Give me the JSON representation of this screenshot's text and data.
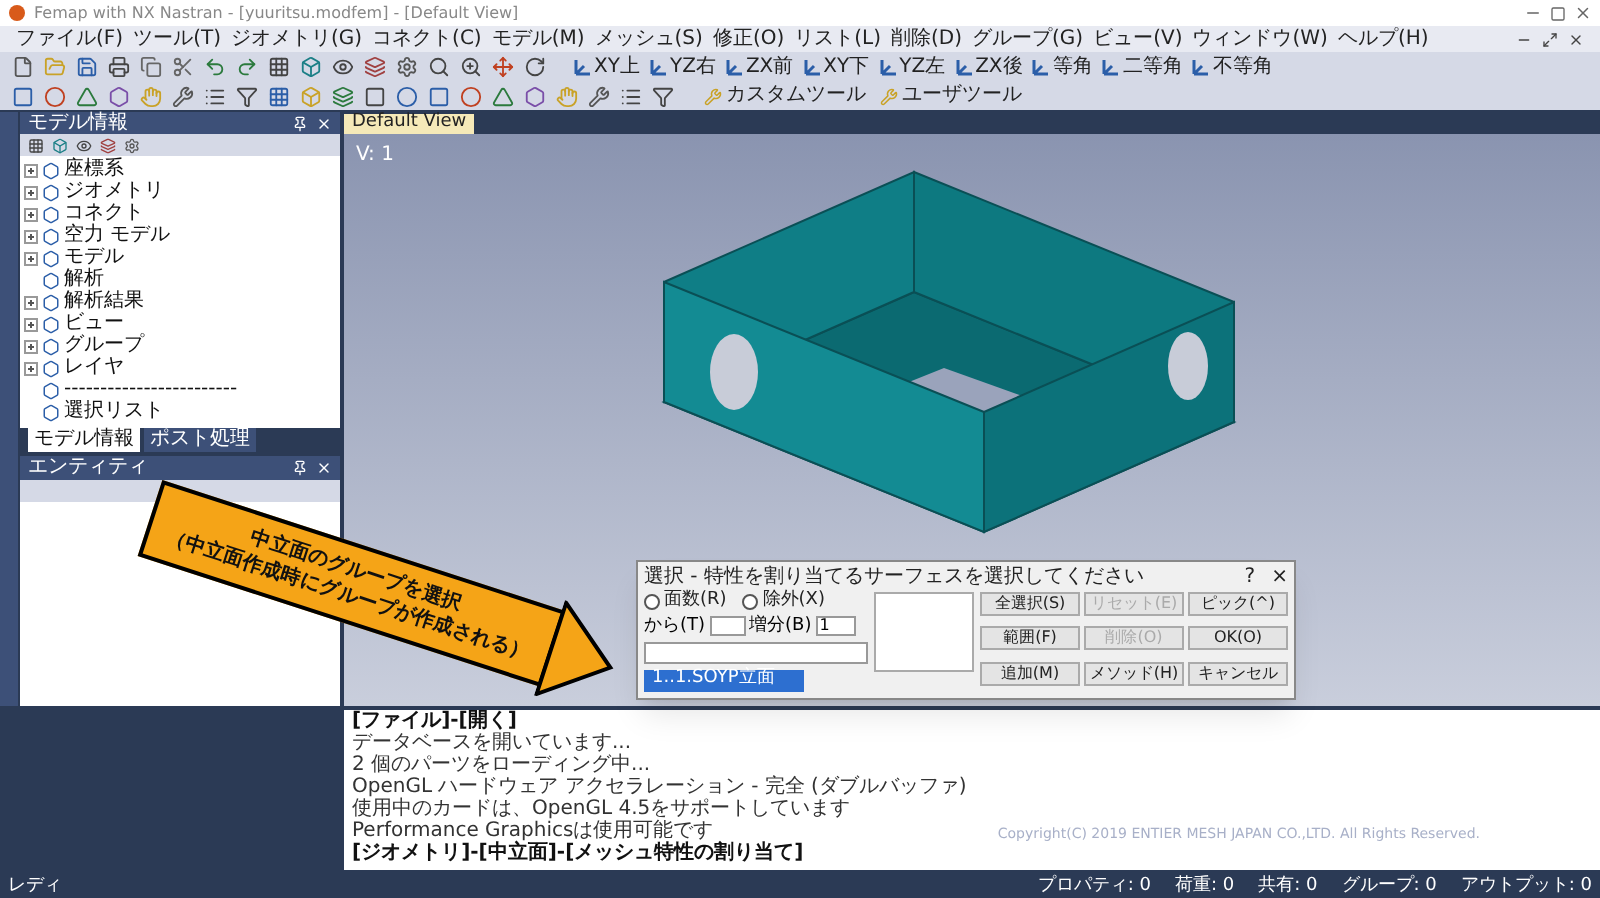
{
  "window": {
    "title": "Femap with NX Nastran - [yuuritsu.modfem] - [Default View]"
  },
  "menu": [
    "ファイル(F)",
    "ツール(T)",
    "ジオメトリ(G)",
    "コネクト(C)",
    "モデル(M)",
    "メッシュ(S)",
    "修正(O)",
    "リスト(L)",
    "削除(D)",
    "グループ(G)",
    "ビュー(V)",
    "ウィンドウ(W)",
    "ヘルプ(H)"
  ],
  "view_buttons": [
    "XY上",
    "YZ右",
    "ZX前",
    "XY下",
    "YZ左",
    "ZX後",
    "等角",
    "二等角",
    "不等角"
  ],
  "tool_buttons": [
    "カスタムツール",
    "ユーザツール"
  ],
  "model_info": {
    "title": "モデル情報",
    "tree": [
      {
        "label": "座標系",
        "expandable": true
      },
      {
        "label": "ジオメトリ",
        "expandable": true
      },
      {
        "label": "コネクト",
        "expandable": true
      },
      {
        "label": "空力 モデル",
        "expandable": true
      },
      {
        "label": "モデル",
        "expandable": true
      },
      {
        "label": "解析",
        "expandable": false
      },
      {
        "label": "解析結果",
        "expandable": true
      },
      {
        "label": "ビュー",
        "expandable": true
      },
      {
        "label": "グループ",
        "expandable": true
      },
      {
        "label": "レイヤ",
        "expandable": true
      },
      {
        "label": "------------------------",
        "expandable": false
      },
      {
        "label": "選択リスト",
        "expandable": false
      }
    ],
    "tabs": [
      {
        "label": "モデル情報",
        "selected": true
      },
      {
        "label": "ポスト処理",
        "selected": false
      }
    ]
  },
  "entity_panel": {
    "title": "エンティティ"
  },
  "view_tab": {
    "label": "Default View",
    "viewport_label": "V: 1"
  },
  "dialog": {
    "title": "選択 - 特性を割り当てるサーフェスを選択してください",
    "help": "?",
    "close": "×",
    "radios": [
      {
        "label": "面数(R)",
        "selected": false
      },
      {
        "label": "除外(X)",
        "selected": false
      }
    ],
    "from_label": "から(T)",
    "step_label": "増分(B)",
    "step_value": "1",
    "dropdown_item": "1..1.SOYP立面",
    "buttons": [
      {
        "label": "全選択(S)",
        "disabled": false
      },
      {
        "label": "リセット(E)",
        "disabled": true
      },
      {
        "label": "ピック(^)",
        "disabled": false
      },
      {
        "label": "範囲(F)",
        "disabled": false
      },
      {
        "label": "削除(O)",
        "disabled": true
      },
      {
        "label": "OK(O)",
        "disabled": false
      },
      {
        "label": "追加(M)",
        "disabled": false
      },
      {
        "label": "メソッド(H)",
        "disabled": false
      },
      {
        "label": "キャンセル",
        "disabled": false
      }
    ]
  },
  "callout": {
    "line_1": "中立面のグループを選択",
    "line_2": "（中立面作成時にグループが作成される）"
  },
  "messages": [
    {
      "text": "[ファイル]-[開く]",
      "kind": "command"
    },
    {
      "text": "データベースを開いています...",
      "kind": "info"
    },
    {
      "text": "2 個のパーツをローディング中...",
      "kind": "info"
    },
    {
      "text": "OpenGL ハードウェア アクセラレーション - 完全 (ダブルバッファ)",
      "kind": "info"
    },
    {
      "text": "使用中のカードは、OpenGL 4.5をサポートしています",
      "kind": "info"
    },
    {
      "text": "Performance Graphicsは使用可能です",
      "kind": "info"
    },
    {
      "text": "[ジオメトリ]-[中立面]-[メッシュ特性の割り当て]",
      "kind": "command"
    }
  ],
  "copyright": "Copyright(C) 2019 ENTIER MESH JAPAN CO.,LTD. All Rights Reserved.",
  "status_bar": {
    "left": "レディ",
    "counters": [
      "プロパティ: 0",
      "荷重: 0",
      "共有: 0",
      "グループ: 0",
      "アウトプット: 0"
    ]
  }
}
